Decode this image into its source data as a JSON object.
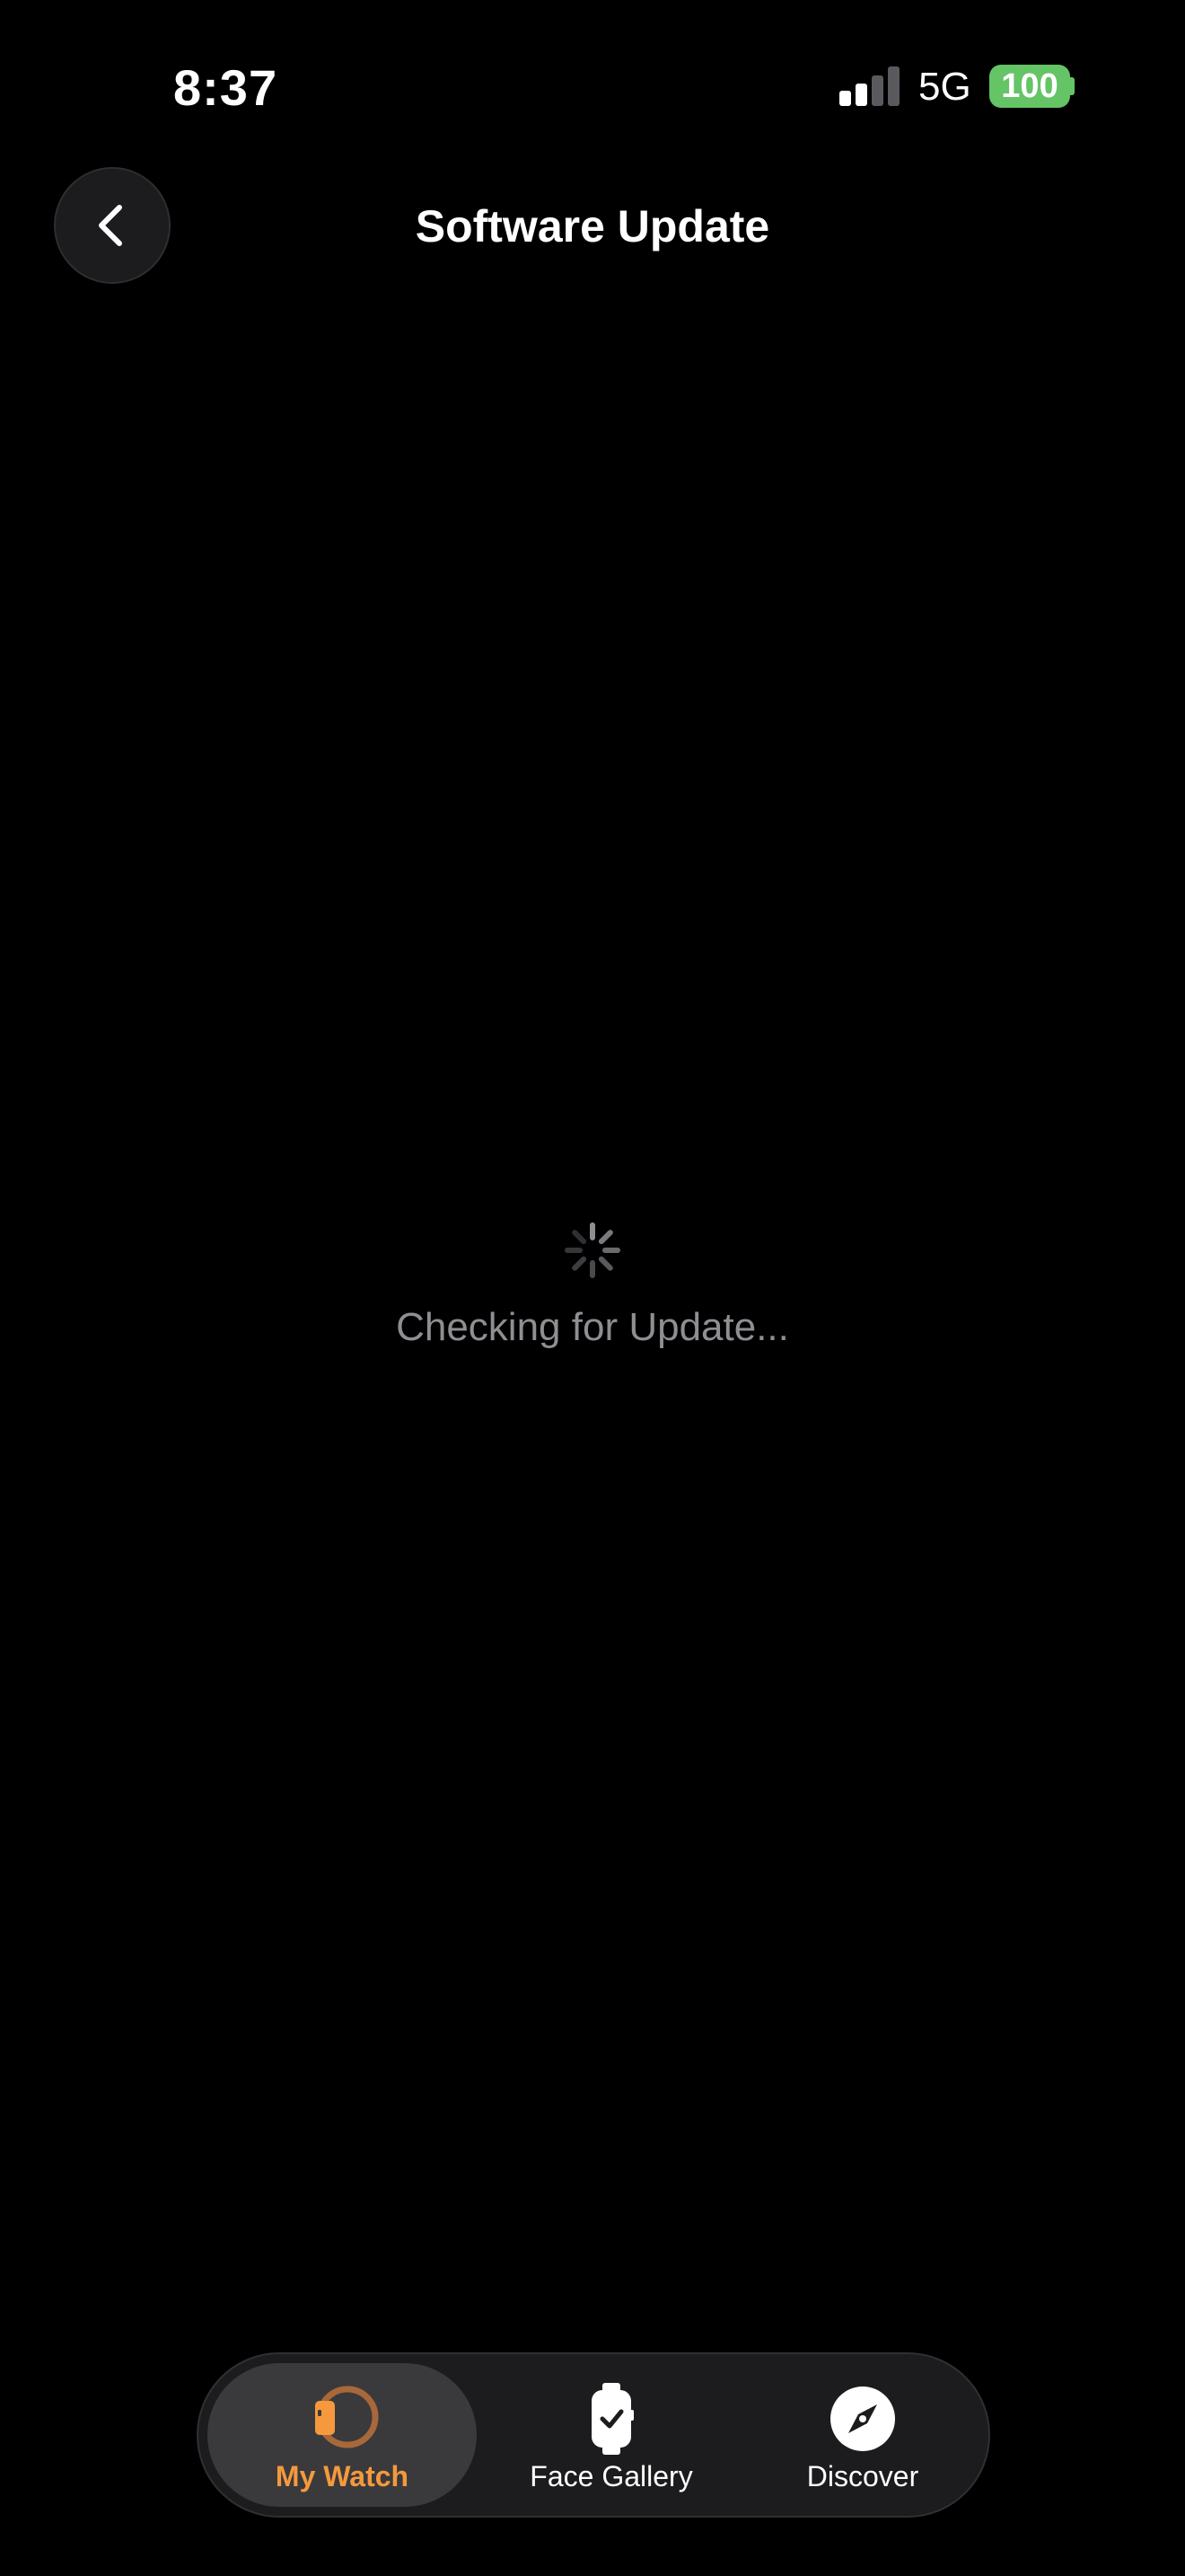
{
  "status_bar": {
    "time": "8:37",
    "network": "5G",
    "battery": "100",
    "signal_bars_active": 2,
    "signal_bars_total": 4
  },
  "nav": {
    "title": "Software Update",
    "back_icon": "chevron-left-icon"
  },
  "content": {
    "loading_text": "Checking for Update..."
  },
  "tabs": [
    {
      "label": "My Watch",
      "icon": "watch-icon",
      "active": true
    },
    {
      "label": "Face Gallery",
      "icon": "watch-face-icon",
      "active": false
    },
    {
      "label": "Discover",
      "icon": "compass-icon",
      "active": false
    }
  ],
  "colors": {
    "background": "#000000",
    "accent": "#f5993c",
    "battery_green": "#65c466",
    "secondary_text": "#8e8e93",
    "tab_bar": "#1c1c1e",
    "tab_active": "#3a3a3c"
  }
}
